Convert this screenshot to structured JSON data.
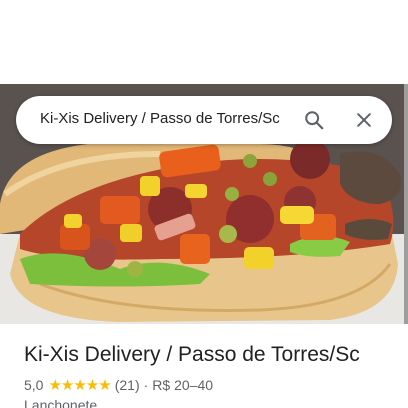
{
  "search": {
    "query": "Ki-Xis Delivery / Passo de Torres/Sc"
  },
  "place": {
    "name": "Ki-Xis Delivery / Passo de Torres/Sc",
    "rating": "5,0",
    "stars": "★★★★★",
    "reviews": "(21)",
    "separator": "·",
    "price": "R$ 20–40",
    "category": "Lanchonete"
  },
  "colors": {
    "star": "#fbbc04",
    "text": "#202124",
    "secondary": "#5f6368"
  },
  "icons": [
    "search-icon",
    "close-icon"
  ]
}
